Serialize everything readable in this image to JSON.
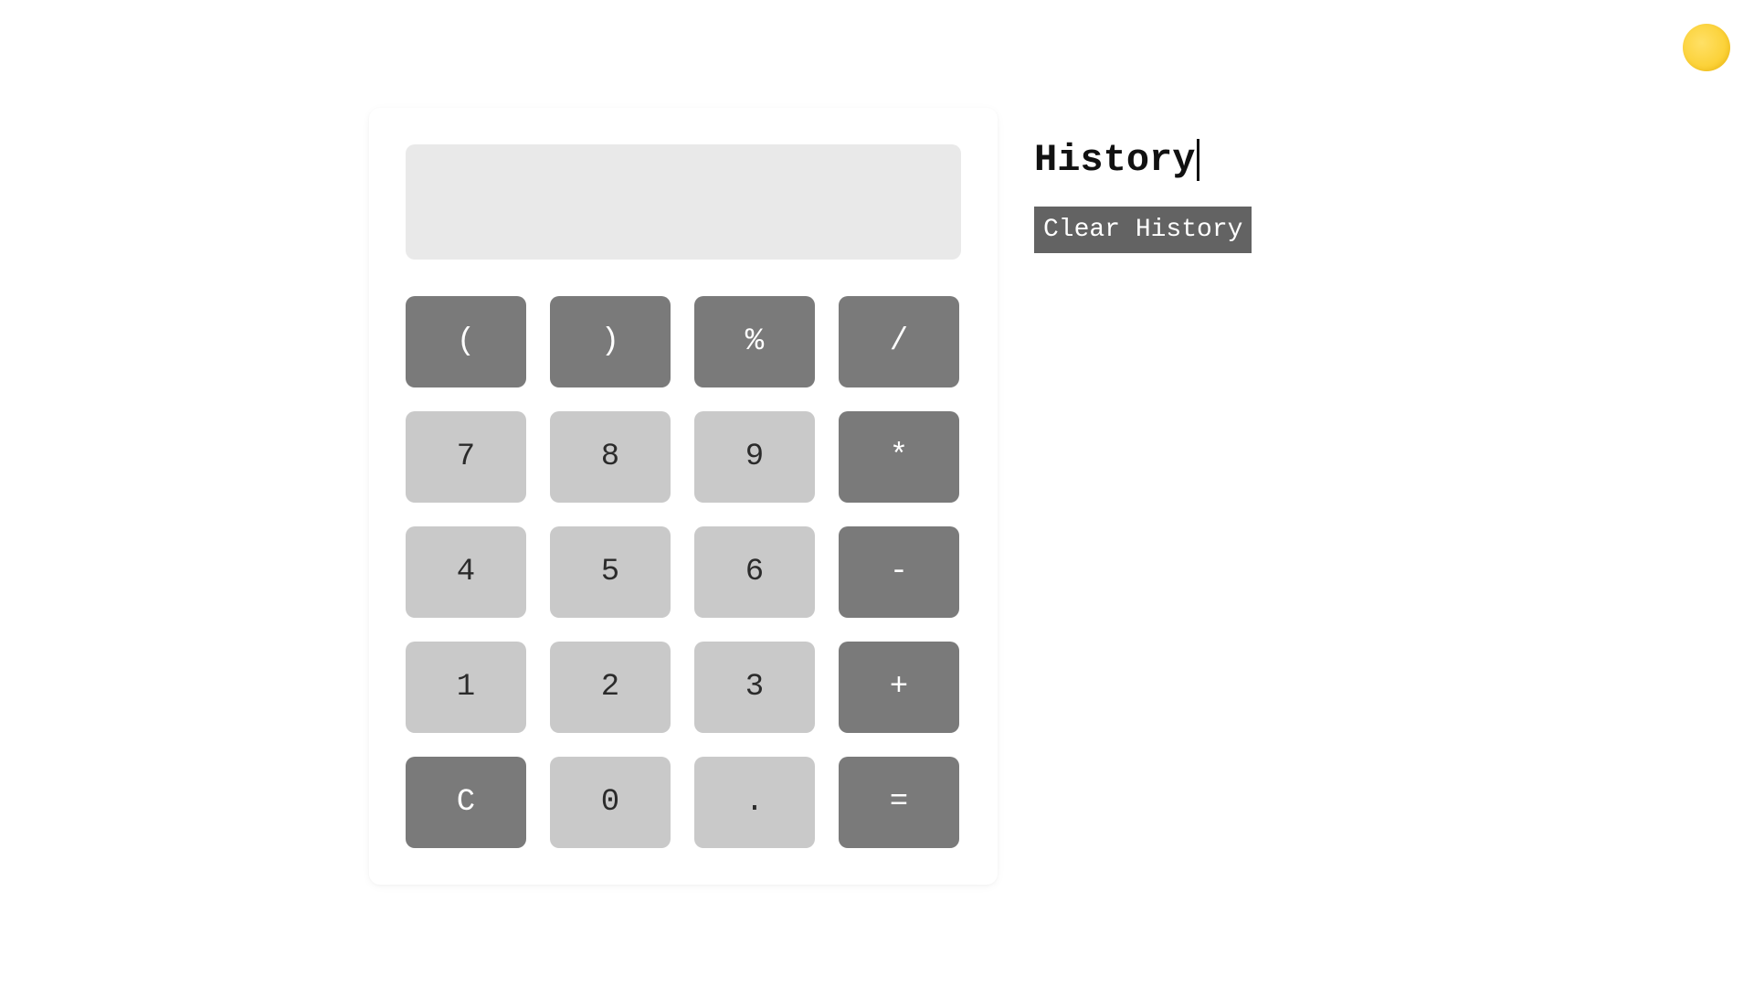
{
  "display": "",
  "keys": {
    "open_paren": "(",
    "close_paren": ")",
    "percent": "%",
    "divide": "/",
    "seven": "7",
    "eight": "8",
    "nine": "9",
    "multiply": "*",
    "four": "4",
    "five": "5",
    "six": "6",
    "minus": "-",
    "one": "1",
    "two": "2",
    "three": "3",
    "plus": "+",
    "clear": "C",
    "zero": "0",
    "decimal": ".",
    "equals": "="
  },
  "history": {
    "title": "History",
    "clear_label": "Clear History",
    "items": []
  }
}
